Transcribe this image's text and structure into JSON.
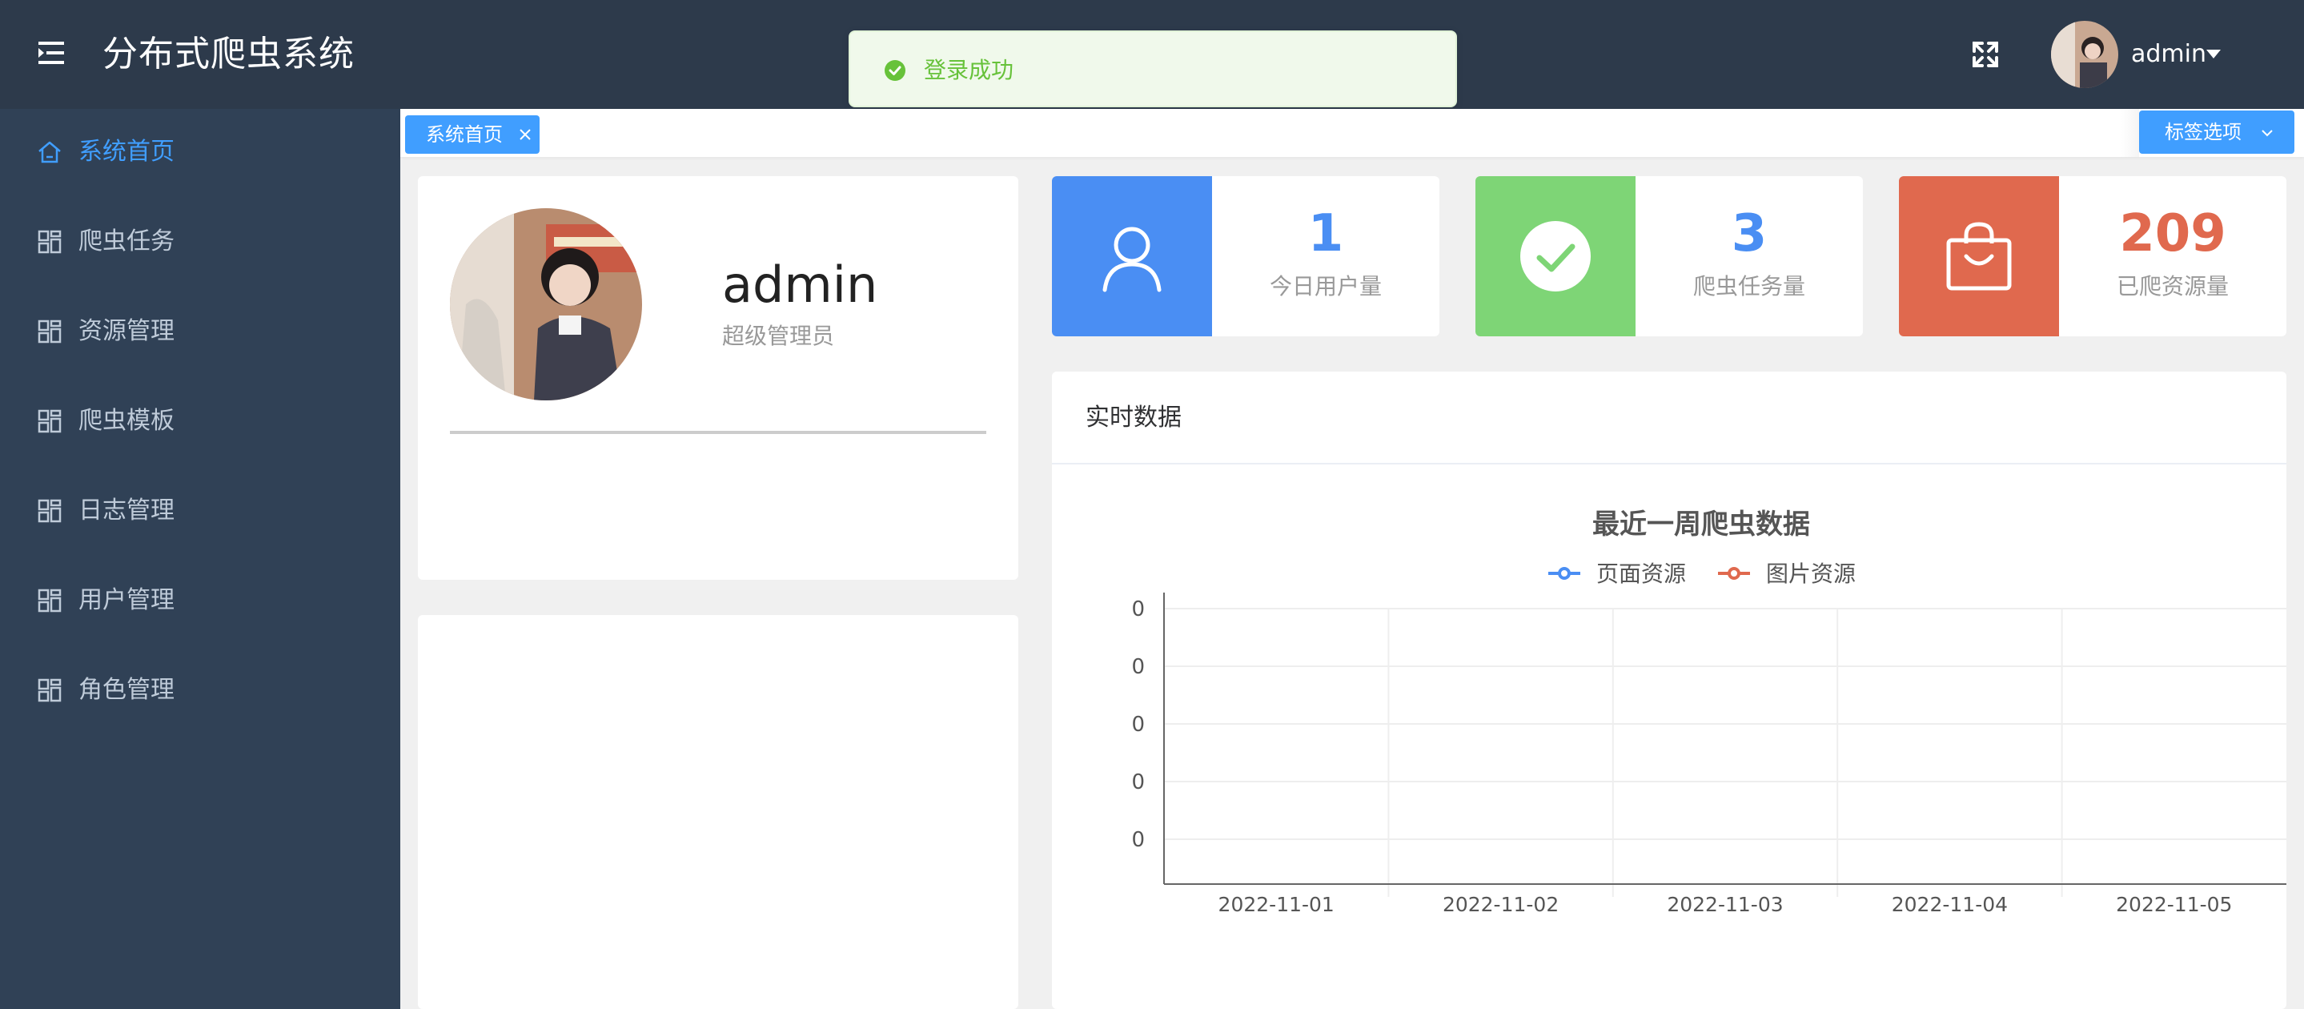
{
  "header": {
    "app_title": "分布式爬虫系统",
    "username": "admin",
    "icons": {
      "menu": "hamburger-menu-icon",
      "fullscreen": "fullscreen-icon"
    },
    "bg_color": "#2d3a4b"
  },
  "toast": {
    "message": "登录成功",
    "color": "#67c23a"
  },
  "sidebar": {
    "items": [
      {
        "label": "系统首页",
        "icon": "home-icon",
        "active": true
      },
      {
        "label": "爬虫任务",
        "icon": "grid-icon"
      },
      {
        "label": "资源管理",
        "icon": "grid-icon"
      },
      {
        "label": "爬虫模板",
        "icon": "grid-icon"
      },
      {
        "label": "日志管理",
        "icon": "grid-icon"
      },
      {
        "label": "用户管理",
        "icon": "grid-icon"
      },
      {
        "label": "角色管理",
        "icon": "grid-icon"
      }
    ],
    "active_color": "#409eff"
  },
  "tags": {
    "items": [
      {
        "label": "系统首页"
      }
    ],
    "options_label": "标签选项"
  },
  "profile": {
    "name": "admin",
    "role": "超级管理员"
  },
  "stats": [
    {
      "value": "1",
      "label": "今日用户量",
      "color": "#4a8ef3",
      "icon": "user-icon"
    },
    {
      "value": "3",
      "label": "爬虫任务量",
      "color": "#7ed576",
      "icon": "check-circle-icon"
    },
    {
      "value": "209",
      "label": "已爬资源量",
      "color": "#e0694e",
      "icon": "shopping-bag-icon"
    }
  ],
  "realtime": {
    "title": "实时数据"
  },
  "chart_data": {
    "type": "line",
    "title": "最近一周爬虫数据",
    "categories": [
      "2022-11-01",
      "2022-11-02",
      "2022-11-03",
      "2022-11-04",
      "2022-11-05"
    ],
    "y_tick_labels": [
      "0",
      "0",
      "0",
      "0",
      "0"
    ],
    "series": [
      {
        "name": "页面资源",
        "color": "#4a8ef3",
        "values": []
      },
      {
        "name": "图片资源",
        "color": "#e0694e",
        "values": []
      }
    ],
    "legend": "top-center",
    "grid": true
  }
}
